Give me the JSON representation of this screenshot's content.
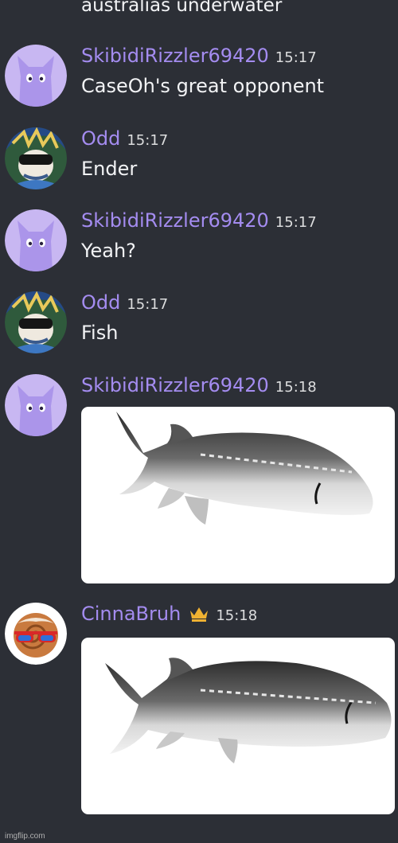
{
  "chat": {
    "previous_message_tail": "australias underwater",
    "messages": [
      {
        "username": "SkibidiRizzler69420",
        "time": "15:17",
        "text": "CaseOh's great opponent",
        "avatar_icon": "purple-cat-avatar-icon"
      },
      {
        "username": "Odd",
        "time": "15:17",
        "text": "Ender",
        "avatar_icon": "cartoon-sunglasses-avatar-icon"
      },
      {
        "username": "SkibidiRizzler69420",
        "time": "15:17",
        "text": "Yeah?",
        "avatar_icon": "purple-cat-avatar-icon"
      },
      {
        "username": "Odd",
        "time": "15:17",
        "text": "Fish",
        "avatar_icon": "cartoon-sunglasses-avatar-icon"
      },
      {
        "username": "SkibidiRizzler69420",
        "time": "15:18",
        "attachment": "fish-image",
        "avatar_icon": "purple-cat-avatar-icon"
      },
      {
        "username": "CinnaBruh",
        "time": "15:18",
        "attachment": "fish-image",
        "avatar_icon": "cinnamon-roll-sunglasses-avatar-icon",
        "badge": "crown-icon"
      }
    ]
  },
  "colors": {
    "background": "#2c2f36",
    "username": "#a48cf0",
    "timestamp": "#dcddde",
    "message_text": "#f2f3f5",
    "crown": "#f0b232"
  },
  "watermark": "imgflip.com"
}
